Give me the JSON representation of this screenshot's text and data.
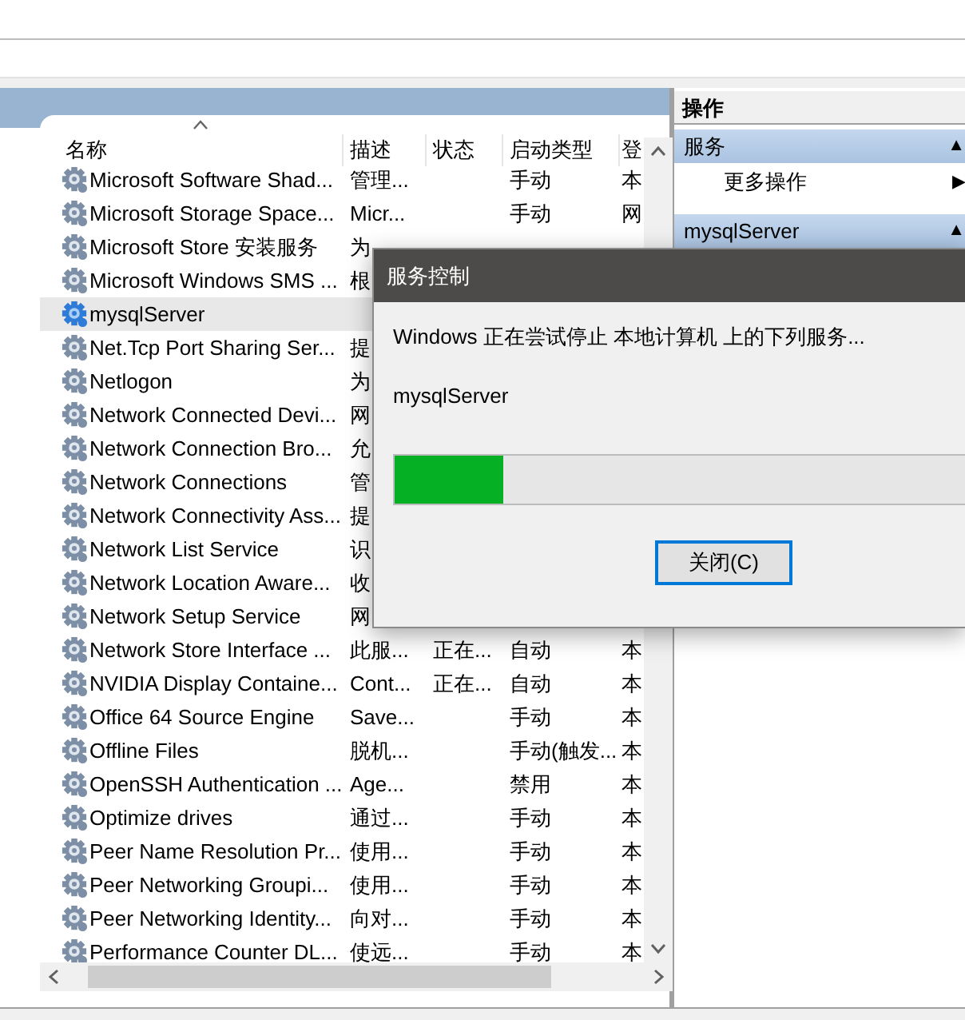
{
  "services_table": {
    "columns": [
      "名称",
      "描述",
      "状态",
      "启动类型",
      "登"
    ],
    "rows": [
      {
        "name": "Microsoft Software Shad...",
        "description": "管理...",
        "startup": "手动",
        "logon": "本",
        "selected": false
      },
      {
        "name": "Microsoft Storage Space...",
        "description": "Micr...",
        "startup": "手动",
        "logon": "网",
        "selected": false
      },
      {
        "name": "Microsoft Store 安装服务",
        "description": "为",
        "selected": false
      },
      {
        "name": "Microsoft Windows SMS ...",
        "description": "根",
        "selected": false
      },
      {
        "name": "mysqlServer",
        "selected": true
      },
      {
        "name": "Net.Tcp Port Sharing Ser...",
        "description": "提",
        "selected": false
      },
      {
        "name": "Netlogon",
        "description": "为",
        "selected": false
      },
      {
        "name": "Network Connected Devi...",
        "description": "网",
        "selected": false
      },
      {
        "name": "Network Connection Bro...",
        "description": "允",
        "selected": false
      },
      {
        "name": "Network Connections",
        "description": "管",
        "selected": false
      },
      {
        "name": "Network Connectivity Ass...",
        "description": "提",
        "selected": false
      },
      {
        "name": "Network List Service",
        "description": "识",
        "selected": false
      },
      {
        "name": "Network Location Aware...",
        "description": "收",
        "selected": false
      },
      {
        "name": "Network Setup Service",
        "description": "网",
        "selected": false
      },
      {
        "name": "Network Store Interface ...",
        "description": "此服...",
        "status": "正在...",
        "startup": "自动",
        "logon": "本",
        "selected": false
      },
      {
        "name": "NVIDIA Display Containe...",
        "description": "Cont...",
        "status": "正在...",
        "startup": "自动",
        "logon": "本",
        "selected": false
      },
      {
        "name": "Office 64 Source Engine",
        "description": "Save...",
        "startup": "手动",
        "logon": "本",
        "selected": false
      },
      {
        "name": "Offline Files",
        "description": "脱机...",
        "startup": "手动(触发...",
        "logon": "本",
        "selected": false
      },
      {
        "name": "OpenSSH Authentication ...",
        "description": "Age...",
        "startup": "禁用",
        "logon": "本",
        "selected": false
      },
      {
        "name": "Optimize drives",
        "description": "通过...",
        "startup": "手动",
        "logon": "本",
        "selected": false
      },
      {
        "name": "Peer Name Resolution Pr...",
        "description": "使用...",
        "startup": "手动",
        "logon": "本",
        "selected": false
      },
      {
        "name": "Peer Networking Groupi...",
        "description": "使用...",
        "startup": "手动",
        "logon": "本",
        "selected": false
      },
      {
        "name": "Peer Networking Identity...",
        "description": "向对...",
        "startup": "手动",
        "logon": "本",
        "selected": false
      },
      {
        "name": "Performance Counter DL...",
        "description": "使远...",
        "startup": "手动",
        "logon": "本",
        "selected": false
      }
    ]
  },
  "actions_pane": {
    "title": "操作",
    "sections": [
      {
        "kind": "group",
        "label": "服务",
        "arrow": "▲"
      },
      {
        "kind": "item",
        "label": "更多操作",
        "arrow": "▶"
      },
      {
        "kind": "group",
        "label": "mysqlServer",
        "arrow": "▲"
      }
    ]
  },
  "dialog": {
    "title": "服务控制",
    "message": "Windows 正在尝试停止 本地计算机 上的下列服务...",
    "service": "mysqlServer",
    "progress": {
      "level": 0.19
    },
    "button": "关闭(C)"
  }
}
